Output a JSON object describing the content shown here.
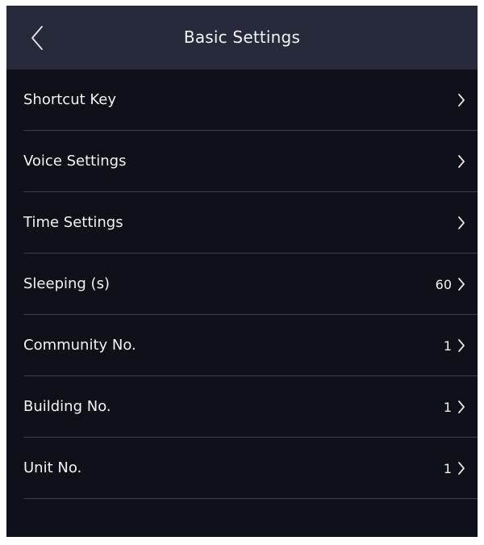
{
  "header": {
    "title": "Basic Settings",
    "back_icon": "chevron-left-icon"
  },
  "rows": [
    {
      "label": "Shortcut Key",
      "value": ""
    },
    {
      "label": "Voice Settings",
      "value": ""
    },
    {
      "label": "Time Settings",
      "value": ""
    },
    {
      "label": "Sleeping (s)",
      "value": "60"
    },
    {
      "label": "Community No.",
      "value": "1"
    },
    {
      "label": "Building No.",
      "value": "1"
    },
    {
      "label": "Unit No.",
      "value": "1"
    }
  ],
  "colors": {
    "background": "#0f1118",
    "header": "#262a3a",
    "divider": "#3a3d4a",
    "text": "#f2f2f4"
  }
}
